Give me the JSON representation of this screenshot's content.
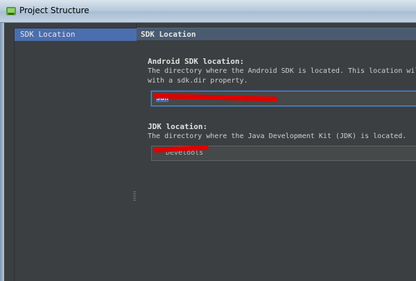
{
  "window": {
    "title": "Project Structure"
  },
  "sidebar": {
    "items": [
      {
        "label": "SDK Location",
        "selected": true
      }
    ]
  },
  "content": {
    "header": "SDK Location",
    "android_sdk": {
      "title": "Android SDK location:",
      "description_line1": "The directory where the Android SDK is located. This location will b",
      "description_line2": "with a sdk.dir property.",
      "value_visible": "sdk"
    },
    "jdk": {
      "title": "JDK location:",
      "description": "The directory where the Java Development Kit (JDK) is located.",
      "value_visible": "Develools"
    }
  },
  "colors": {
    "accent": "#4b6eaf",
    "background": "#3c3f41",
    "redaction": "#e00000"
  },
  "icons": {
    "app": "android-studio-icon",
    "grip": "splitter-grip-icon"
  }
}
